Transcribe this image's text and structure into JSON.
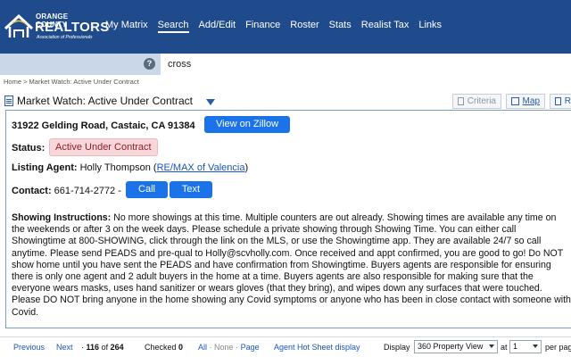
{
  "logo": {
    "line1": "ORANGE COUNTY",
    "line2": "REALTORS",
    "line3": "Association of Professionals"
  },
  "nav": {
    "items": [
      {
        "label": "My Matrix"
      },
      {
        "label": "Search"
      },
      {
        "label": "Add/Edit"
      },
      {
        "label": "Finance"
      },
      {
        "label": "Roster"
      },
      {
        "label": "Stats"
      },
      {
        "label": "Realist Tax"
      },
      {
        "label": "Links"
      }
    ],
    "active": "Search"
  },
  "search": {
    "help_icon": "?",
    "value": "cross"
  },
  "breadcrumb": "Home > Market Watch: Active Under Contract",
  "title": "Market Watch: Active Under Contract",
  "toolbar": {
    "criteria_label": "Criteria",
    "map_label": "Map",
    "r_label": "R"
  },
  "listing": {
    "address": "31922 Gelding Road, Castaic, CA 91384",
    "zillow_button": "View on Zillow",
    "status_label": "Status:",
    "status_value": "Active Under Contract",
    "agent_label": "Listing Agent:",
    "agent_name": "Holly Thompson (",
    "agent_office": "RE/MAX of Valencia",
    "agent_close": ")",
    "contact_label": "Contact:",
    "contact_phone": "661-714-2772 -",
    "call_button": "Call",
    "text_button": "Text",
    "instructions_label": "Showing Instructions:",
    "instructions_text": "No more showings at this time. Multiple counters are out already. Showing times are available any time on the weekends or after 3 on the week days. Please schedule a private showing through Showing Time. You can either call Showingtime at 800-SHOWING, click through the link on the MLS, or use the Showingtime app. They are available 24/7 so call anytime. Please send PEADS and pre-qual to Holly@scvholly.com. Once received and appt confirmed, you are good to go! Do NOT show home until you have sent the PEADS and have confirmation from Showingtime. Buyers agents are responsible for ensuring there is only one agent and 2 adult buyers in the home at a time. Buyers agents are also responsible for making sure that the everyone wears masks, uses hand sanitizer or wears gloves (that they bring), and wipes down any surfaces that were touched. Please DO NOT bring anyone in the home showing any Covid symptoms or anyone who has been in close contact with someone with Covid."
  },
  "pager": {
    "previous": "Previous",
    "next": "Next",
    "dot": "·",
    "current": "116",
    "of": "of",
    "total": "264",
    "checked_label": "Checked",
    "checked_count": "0",
    "all": "All",
    "none": "None",
    "page": "Page",
    "hot_sheet": "Agent Hot Sheet display",
    "display_label": "Display",
    "display_value": "360 Property View",
    "at_label": "at",
    "per_page_value": "1",
    "per_page_label": "per pag"
  },
  "colors": {
    "brand": "#1f4b8c",
    "button": "#1a73e8",
    "status_bg": "#f8d7da"
  }
}
